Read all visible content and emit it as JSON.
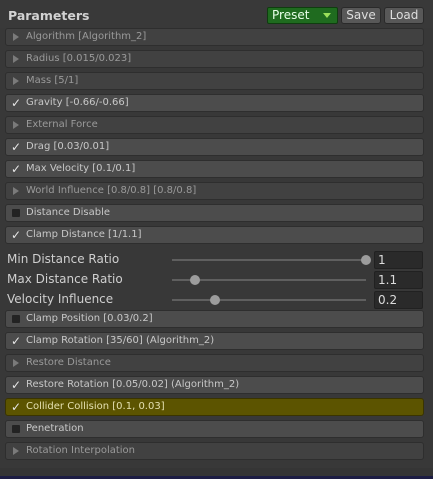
{
  "header": {
    "title": "Parameters",
    "preset_label": "Preset",
    "save_label": "Save",
    "load_label": "Load",
    "preset_color": "#1f6b1f"
  },
  "rows_top": [
    {
      "label": "Algorithm [Algorithm_2]",
      "state": "collapsed"
    },
    {
      "label": "Radius [0.015/0.023]",
      "state": "collapsed"
    },
    {
      "label": "Mass [5/1]",
      "state": "collapsed"
    },
    {
      "label": "Gravity [-0.66/-0.66]",
      "state": "checked"
    },
    {
      "label": "External Force",
      "state": "collapsed"
    },
    {
      "label": "Drag [0.03/0.01]",
      "state": "checked"
    },
    {
      "label": "Max Velocity [0.1/0.1]",
      "state": "checked"
    },
    {
      "label": "World Influence [0.8/0.8] [0.8/0.8]",
      "state": "collapsed"
    },
    {
      "label": "Distance Disable",
      "state": "unchecked"
    },
    {
      "label": "Clamp Distance [1/1.1]",
      "state": "checked"
    }
  ],
  "sliders": [
    {
      "label": "Min Distance Ratio",
      "value": "1",
      "fraction": 1.0
    },
    {
      "label": "Max Distance Ratio",
      "value": "1.1",
      "fraction": 0.12
    },
    {
      "label": "Velocity Influence",
      "value": "0.2",
      "fraction": 0.22
    }
  ],
  "rows_bottom": [
    {
      "label": "Clamp Position [0.03/0.2]",
      "state": "unchecked"
    },
    {
      "label": "Clamp Rotation [35/60] (Algorithm_2)",
      "state": "checked"
    },
    {
      "label": "Restore Distance",
      "state": "collapsed"
    },
    {
      "label": "Restore Rotation [0.05/0.02] (Algorithm_2)",
      "state": "checked"
    },
    {
      "label": "Collider Collision [0.1, 0.03]",
      "state": "checked",
      "highlight": true
    },
    {
      "label": "Penetration",
      "state": "unchecked"
    },
    {
      "label": "Rotation Interpolation",
      "state": "collapsed"
    }
  ]
}
